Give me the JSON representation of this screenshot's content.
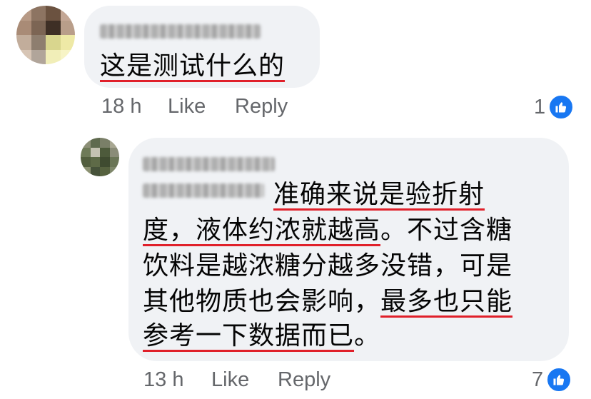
{
  "comment1": {
    "author": "",
    "text": "这是测试什么的",
    "time": "18 h",
    "like_label": "Like",
    "reply_label": "Reply",
    "reaction_count": "1",
    "reaction_icon": "thumbs-up-icon"
  },
  "comment2": {
    "author": "",
    "lines": [
      "准确来说是验折射",
      "度，液体约浓就越高",
      "。不过含糖",
      "饮料是越浓糖分越多没错，可是",
      "其他物质也会影响，",
      "最多也只能",
      "参考一下数据而已",
      "。"
    ],
    "time": "13 h",
    "like_label": "Like",
    "reply_label": "Reply",
    "reaction_count": "7",
    "reaction_icon": "thumbs-up-icon"
  },
  "colors": {
    "bubble": "#f0f2f5",
    "meta_text": "#65676b",
    "like_blue": "#1877f2",
    "underline_red": "#e0202a"
  }
}
